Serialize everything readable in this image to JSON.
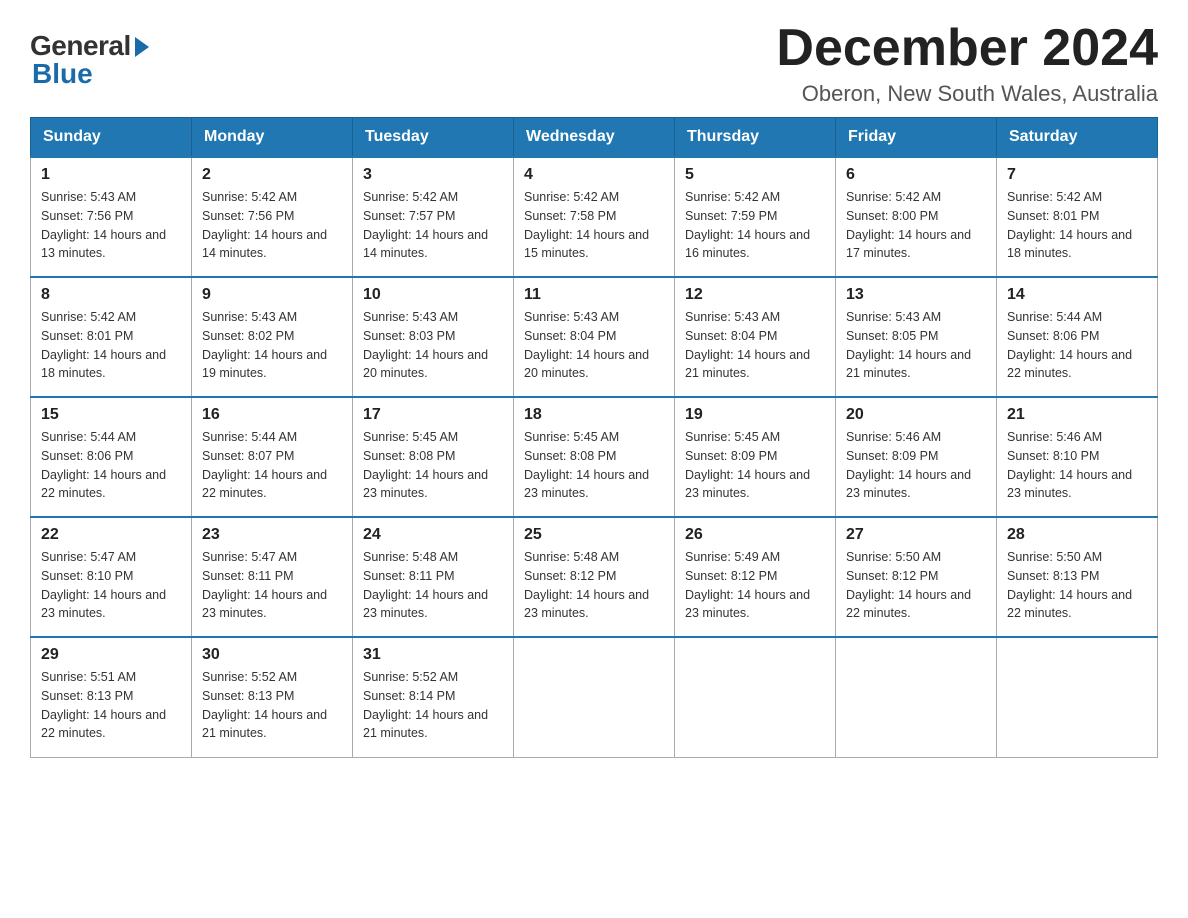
{
  "logo": {
    "general_text": "General",
    "blue_text": "Blue"
  },
  "header": {
    "month_year": "December 2024",
    "location": "Oberon, New South Wales, Australia"
  },
  "weekdays": [
    "Sunday",
    "Monday",
    "Tuesday",
    "Wednesday",
    "Thursday",
    "Friday",
    "Saturday"
  ],
  "weeks": [
    [
      {
        "day": "1",
        "sunrise": "5:43 AM",
        "sunset": "7:56 PM",
        "daylight": "14 hours and 13 minutes."
      },
      {
        "day": "2",
        "sunrise": "5:42 AM",
        "sunset": "7:56 PM",
        "daylight": "14 hours and 14 minutes."
      },
      {
        "day": "3",
        "sunrise": "5:42 AM",
        "sunset": "7:57 PM",
        "daylight": "14 hours and 14 minutes."
      },
      {
        "day": "4",
        "sunrise": "5:42 AM",
        "sunset": "7:58 PM",
        "daylight": "14 hours and 15 minutes."
      },
      {
        "day": "5",
        "sunrise": "5:42 AM",
        "sunset": "7:59 PM",
        "daylight": "14 hours and 16 minutes."
      },
      {
        "day": "6",
        "sunrise": "5:42 AM",
        "sunset": "8:00 PM",
        "daylight": "14 hours and 17 minutes."
      },
      {
        "day": "7",
        "sunrise": "5:42 AM",
        "sunset": "8:01 PM",
        "daylight": "14 hours and 18 minutes."
      }
    ],
    [
      {
        "day": "8",
        "sunrise": "5:42 AM",
        "sunset": "8:01 PM",
        "daylight": "14 hours and 18 minutes."
      },
      {
        "day": "9",
        "sunrise": "5:43 AM",
        "sunset": "8:02 PM",
        "daylight": "14 hours and 19 minutes."
      },
      {
        "day": "10",
        "sunrise": "5:43 AM",
        "sunset": "8:03 PM",
        "daylight": "14 hours and 20 minutes."
      },
      {
        "day": "11",
        "sunrise": "5:43 AM",
        "sunset": "8:04 PM",
        "daylight": "14 hours and 20 minutes."
      },
      {
        "day": "12",
        "sunrise": "5:43 AM",
        "sunset": "8:04 PM",
        "daylight": "14 hours and 21 minutes."
      },
      {
        "day": "13",
        "sunrise": "5:43 AM",
        "sunset": "8:05 PM",
        "daylight": "14 hours and 21 minutes."
      },
      {
        "day": "14",
        "sunrise": "5:44 AM",
        "sunset": "8:06 PM",
        "daylight": "14 hours and 22 minutes."
      }
    ],
    [
      {
        "day": "15",
        "sunrise": "5:44 AM",
        "sunset": "8:06 PM",
        "daylight": "14 hours and 22 minutes."
      },
      {
        "day": "16",
        "sunrise": "5:44 AM",
        "sunset": "8:07 PM",
        "daylight": "14 hours and 22 minutes."
      },
      {
        "day": "17",
        "sunrise": "5:45 AM",
        "sunset": "8:08 PM",
        "daylight": "14 hours and 23 minutes."
      },
      {
        "day": "18",
        "sunrise": "5:45 AM",
        "sunset": "8:08 PM",
        "daylight": "14 hours and 23 minutes."
      },
      {
        "day": "19",
        "sunrise": "5:45 AM",
        "sunset": "8:09 PM",
        "daylight": "14 hours and 23 minutes."
      },
      {
        "day": "20",
        "sunrise": "5:46 AM",
        "sunset": "8:09 PM",
        "daylight": "14 hours and 23 minutes."
      },
      {
        "day": "21",
        "sunrise": "5:46 AM",
        "sunset": "8:10 PM",
        "daylight": "14 hours and 23 minutes."
      }
    ],
    [
      {
        "day": "22",
        "sunrise": "5:47 AM",
        "sunset": "8:10 PM",
        "daylight": "14 hours and 23 minutes."
      },
      {
        "day": "23",
        "sunrise": "5:47 AM",
        "sunset": "8:11 PM",
        "daylight": "14 hours and 23 minutes."
      },
      {
        "day": "24",
        "sunrise": "5:48 AM",
        "sunset": "8:11 PM",
        "daylight": "14 hours and 23 minutes."
      },
      {
        "day": "25",
        "sunrise": "5:48 AM",
        "sunset": "8:12 PM",
        "daylight": "14 hours and 23 minutes."
      },
      {
        "day": "26",
        "sunrise": "5:49 AM",
        "sunset": "8:12 PM",
        "daylight": "14 hours and 23 minutes."
      },
      {
        "day": "27",
        "sunrise": "5:50 AM",
        "sunset": "8:12 PM",
        "daylight": "14 hours and 22 minutes."
      },
      {
        "day": "28",
        "sunrise": "5:50 AM",
        "sunset": "8:13 PM",
        "daylight": "14 hours and 22 minutes."
      }
    ],
    [
      {
        "day": "29",
        "sunrise": "5:51 AM",
        "sunset": "8:13 PM",
        "daylight": "14 hours and 22 minutes."
      },
      {
        "day": "30",
        "sunrise": "5:52 AM",
        "sunset": "8:13 PM",
        "daylight": "14 hours and 21 minutes."
      },
      {
        "day": "31",
        "sunrise": "5:52 AM",
        "sunset": "8:14 PM",
        "daylight": "14 hours and 21 minutes."
      },
      null,
      null,
      null,
      null
    ]
  ],
  "labels": {
    "sunrise": "Sunrise:",
    "sunset": "Sunset:",
    "daylight": "Daylight:"
  }
}
